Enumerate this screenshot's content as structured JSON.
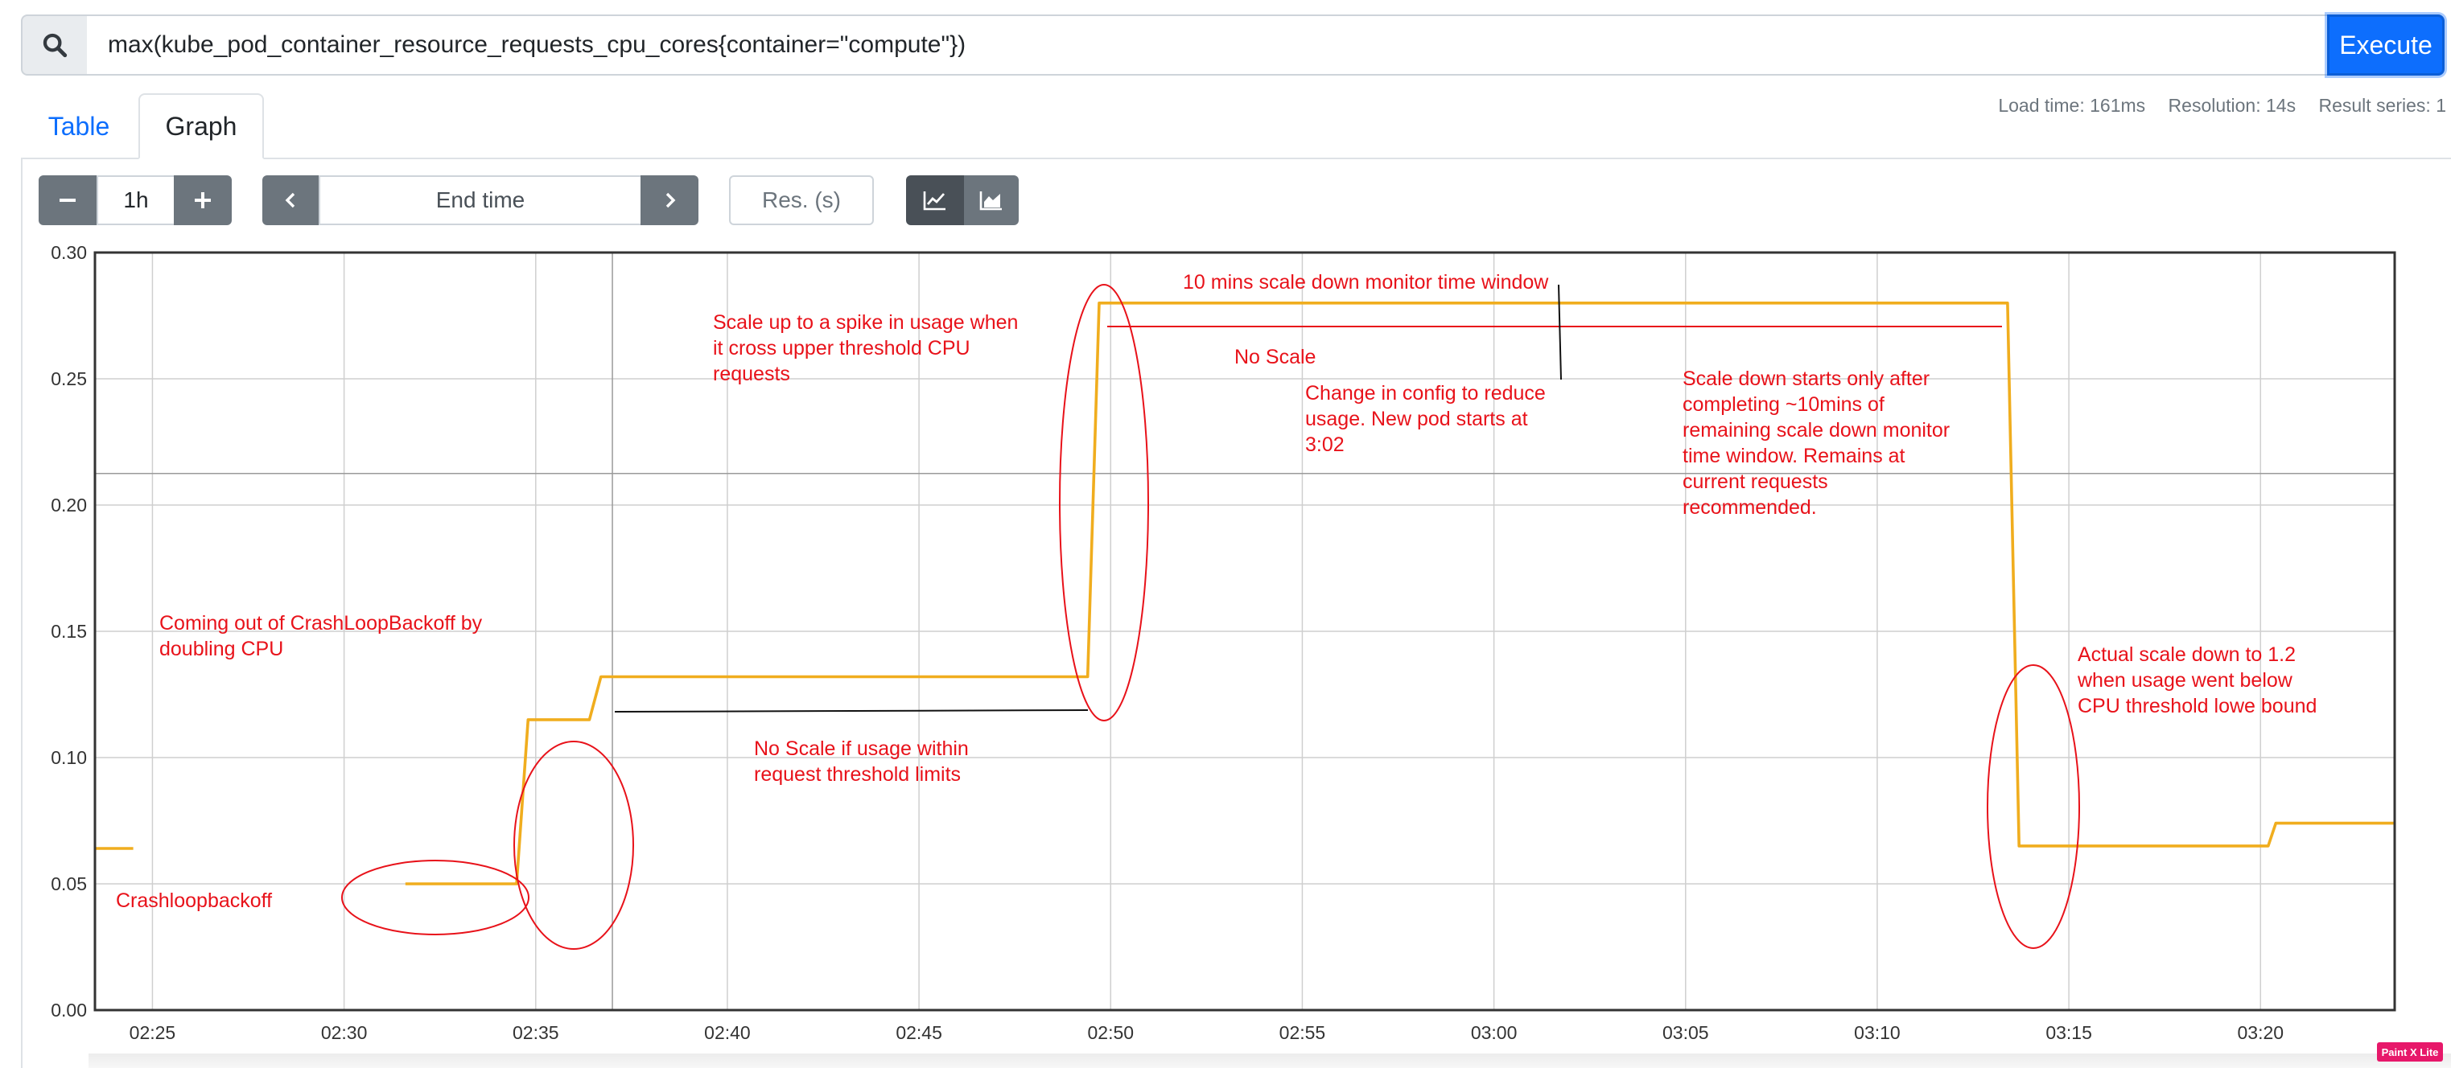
{
  "query": {
    "expression": "max(kube_pod_container_resource_requests_cpu_cores{container=\"compute\"})",
    "execute_label": "Execute"
  },
  "tabs": [
    {
      "label": "Table",
      "active": false
    },
    {
      "label": "Graph",
      "active": true
    }
  ],
  "stats": {
    "load_time": "Load time: 161ms",
    "resolution": "Resolution: 14s",
    "result_series": "Result series: 1"
  },
  "graph_controls": {
    "range": "1h",
    "end_time_placeholder": "End time",
    "resolution_placeholder": "Res. (s)",
    "minus_icon": "minus-icon",
    "plus_icon": "plus-icon",
    "prev_icon": "chevron-left-icon",
    "next_icon": "chevron-right-icon",
    "line_mode_icon": "line-chart-icon",
    "stacked_mode_icon": "area-chart-icon",
    "active_mode": "line"
  },
  "colors": {
    "series": "#f0ad1e",
    "annotation": "#e8121a",
    "accent": "#0d6efd"
  },
  "annotations": [
    {
      "id": "crashloop",
      "lines": [
        "Crashloopbackoff"
      ]
    },
    {
      "id": "coming-out",
      "lines": [
        "Coming out of CrashLoopBackoff by",
        "doubling CPU"
      ]
    },
    {
      "id": "scale-up",
      "lines": [
        "Scale up to a spike in usage when",
        "it cross upper threshold CPU",
        "requests"
      ]
    },
    {
      "id": "no-scale-threshold",
      "lines": [
        "No Scale if usage within",
        "request threshold limits"
      ]
    },
    {
      "id": "ten-mins",
      "lines": [
        "10 mins scale down monitor time window"
      ]
    },
    {
      "id": "no-scale",
      "lines": [
        "No Scale"
      ]
    },
    {
      "id": "config-change",
      "lines": [
        "Change in config to reduce",
        "usage. New pod starts at",
        "3:02"
      ]
    },
    {
      "id": "scale-down-starts",
      "lines": [
        "Scale down starts only after",
        "completing ~10mins of",
        "remaining scale down monitor",
        "time window. Remains at",
        "current requests",
        "recommended."
      ]
    },
    {
      "id": "actual-scale-down",
      "lines": [
        "Actual scale down to 1.2",
        "when usage went below",
        "CPU threshold lowe bound"
      ]
    }
  ],
  "chart_data": {
    "type": "line",
    "x_ticks": [
      "02:25",
      "02:30",
      "02:35",
      "02:40",
      "02:45",
      "02:50",
      "02:55",
      "03:00",
      "03:05",
      "03:10",
      "03:15",
      "03:20"
    ],
    "y_ticks": [
      "0.00",
      "0.05",
      "0.10",
      "0.15",
      "0.20",
      "0.25",
      "0.30"
    ],
    "ylim": [
      0,
      0.3
    ],
    "xlim_minutes": [
      23.5,
      83.5
    ],
    "x_unit_note": "minutes after 02:00",
    "grid": true,
    "series": [
      {
        "segments": [
          [
            [
              23.5,
              0.064
            ],
            [
              24.5,
              0.064
            ]
          ],
          [
            [
              31.6,
              0.05
            ],
            [
              34.5,
              0.05
            ],
            [
              34.8,
              0.115
            ],
            [
              36.4,
              0.115
            ],
            [
              36.7,
              0.132
            ],
            [
              49.4,
              0.132
            ],
            [
              49.7,
              0.28
            ],
            [
              73.4,
              0.28
            ],
            [
              73.7,
              0.065
            ],
            [
              80.2,
              0.065
            ],
            [
              80.4,
              0.074
            ],
            [
              83.5,
              0.074
            ]
          ]
        ]
      }
    ]
  },
  "watermark": "Paint X Lite"
}
